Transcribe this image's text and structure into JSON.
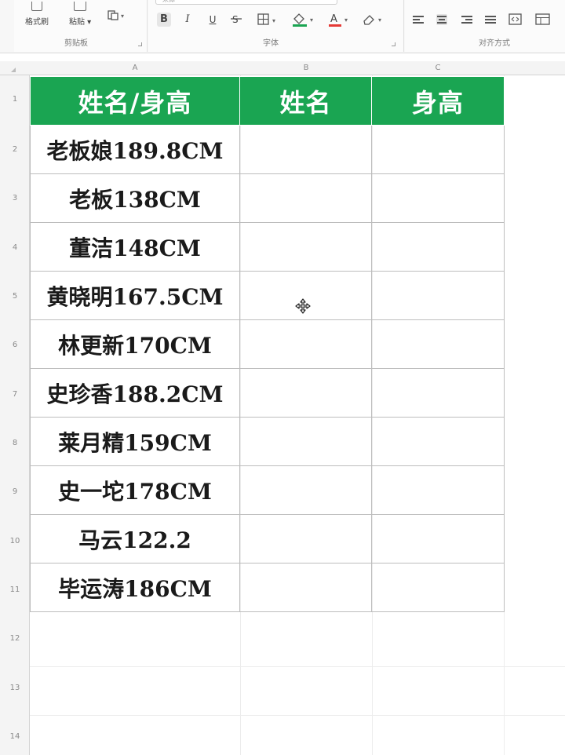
{
  "ribbon": {
    "buttons": {
      "format_painter": "格式刷",
      "paste": "粘贴"
    },
    "font_box_text": "宋体",
    "format": {
      "bold": "B",
      "italic": "I",
      "underline": "U"
    },
    "group_labels": {
      "clipboard": "剪贴板",
      "font": "字体",
      "alignment": "对齐方式"
    }
  },
  "sheet": {
    "columns": [
      "A",
      "B",
      "C"
    ],
    "rows": [
      "1",
      "2",
      "3",
      "4",
      "5",
      "6",
      "7",
      "8",
      "9",
      "10",
      "11",
      "12",
      "13",
      "14"
    ],
    "header": {
      "a": "姓名/身高",
      "b": "姓名",
      "c": "身高"
    },
    "data": [
      {
        "a": "老板娘189.8CM",
        "b": "",
        "c": ""
      },
      {
        "a": "老板138CM",
        "b": "",
        "c": ""
      },
      {
        "a": "董洁148CM",
        "b": "",
        "c": ""
      },
      {
        "a": "黄晓明167.5CM",
        "b": "",
        "c": ""
      },
      {
        "a": "林更新170CM",
        "b": "",
        "c": ""
      },
      {
        "a": "史珍香188.2CM",
        "b": "",
        "c": ""
      },
      {
        "a": "莱月精159CM",
        "b": "",
        "c": ""
      },
      {
        "a": "史一坨178CM",
        "b": "",
        "c": ""
      },
      {
        "a": "马云122.2",
        "b": "",
        "c": ""
      },
      {
        "a": "毕运涛186CM",
        "b": "",
        "c": ""
      }
    ]
  },
  "colors": {
    "header_fill": "#1aa552",
    "header_text": "#ffffff",
    "grid": "#bdbdbd"
  },
  "icons": [
    "format-painter-icon",
    "paste-icon",
    "copy-icon",
    "border-icon",
    "fill-color-icon",
    "font-color-icon",
    "clear-icon",
    "align-left-icon",
    "align-center-icon",
    "align-right-icon",
    "justify-icon",
    "merge-icon",
    "wrap-icon",
    "move-cursor-icon"
  ]
}
